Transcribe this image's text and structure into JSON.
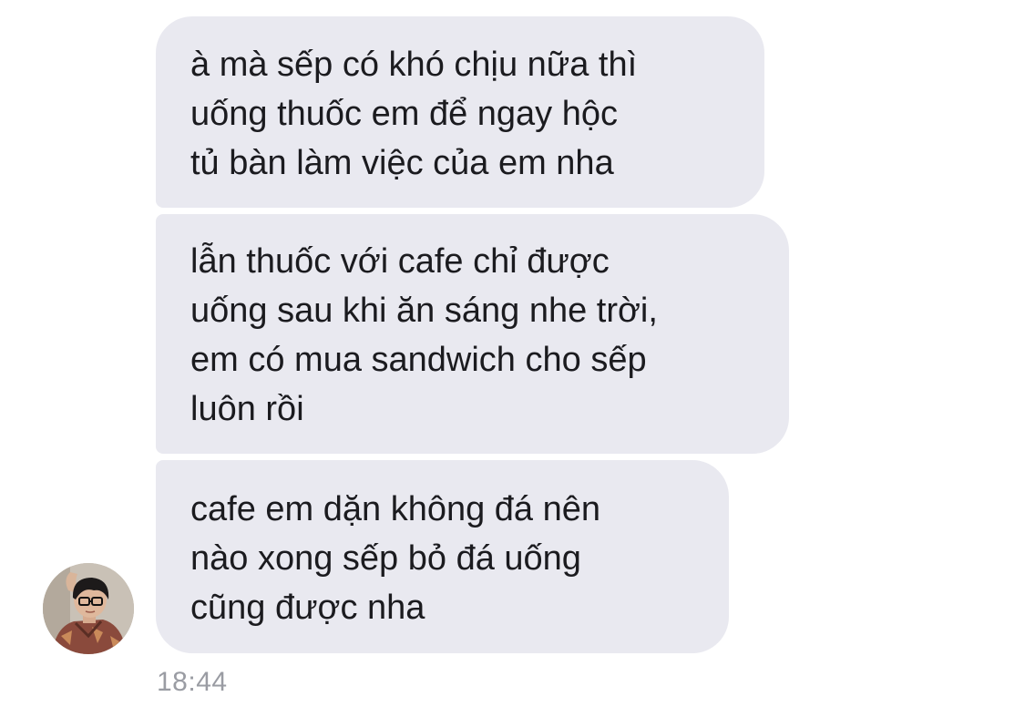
{
  "messages": [
    {
      "text": "à mà sếp có khó chịu nữa thì\nuống thuốc em để ngay hộc\ntủ bàn làm việc của em nha"
    },
    {
      "text": "lẫn thuốc với cafe chỉ được\nuống sau khi ăn sáng nhe trời,\nem có mua sandwich cho sếp\nluôn rồi"
    },
    {
      "text": "cafe em dặn không đá nên\nnào xong sếp bỏ đá uống\ncũng được nha"
    }
  ],
  "timestamp": "18:44",
  "sender": {
    "avatar_icon": "profile-photo"
  },
  "colors": {
    "bubble_background": "#e9e9f0",
    "message_text": "#1b1b1f",
    "timestamp_text": "#9a9ca3",
    "page_background": "#ffffff"
  }
}
